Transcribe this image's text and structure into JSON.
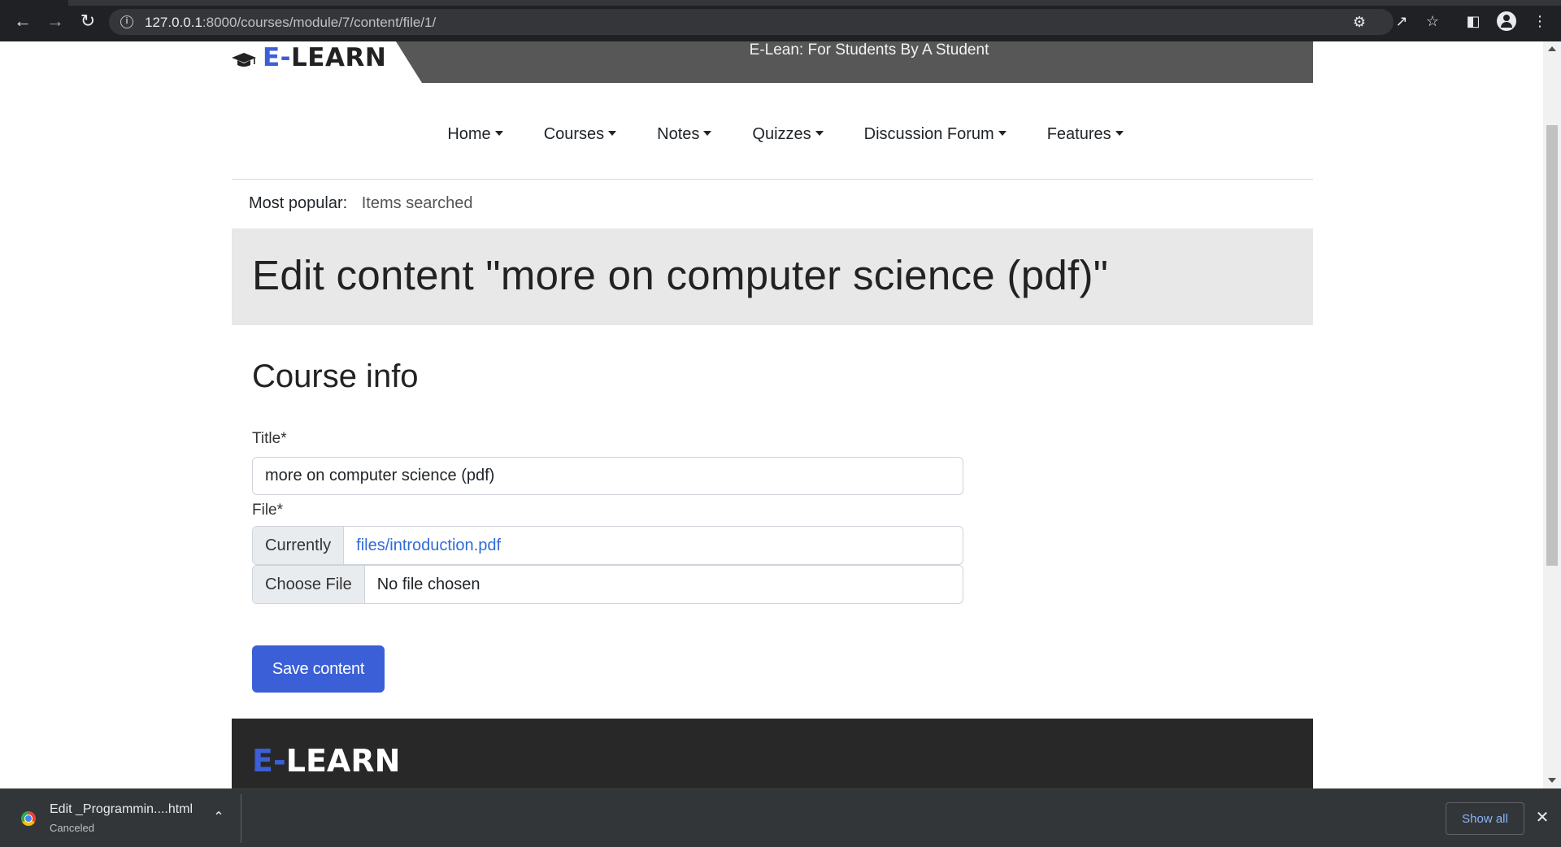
{
  "browser": {
    "url_host": "127.0.0.1",
    "url_rest": ":8000/courses/module/7/content/file/1/",
    "back_icon": "arrow-left-icon",
    "forward_icon": "arrow-right-icon",
    "reload_icon": "reload-icon"
  },
  "header": {
    "logo_e": "E-",
    "logo_rest": "LEARN",
    "tagline": "E-Lean: For Students By A Student"
  },
  "nav": {
    "items": [
      {
        "label": "Home"
      },
      {
        "label": "Courses"
      },
      {
        "label": "Notes"
      },
      {
        "label": "Quizzes"
      },
      {
        "label": "Discussion Forum"
      },
      {
        "label": "Features"
      }
    ]
  },
  "popular": {
    "label": "Most popular:",
    "value": "Items searched"
  },
  "page": {
    "title": "Edit content \"more on computer science (pdf)\"",
    "section_heading": "Course info"
  },
  "form": {
    "title_label": "Title*",
    "title_value": "more on computer science (pdf)",
    "file_label": "File*",
    "currently_label": "Currently",
    "current_file": "files/introduction.pdf",
    "choose_file_label": "Choose File",
    "no_file_text": "No file chosen",
    "save_label": "Save content"
  },
  "footer": {
    "logo_e": "E-",
    "logo_rest": "LEARN"
  },
  "downloads": {
    "file_name": "Edit _Programmin....html",
    "status": "Canceled",
    "show_all": "Show all"
  },
  "colors": {
    "accent": "#3b5fd6",
    "tagline_band": "#575757",
    "title_band": "#e8e8e8",
    "footer": "#282828",
    "link": "#2f6bd8"
  }
}
